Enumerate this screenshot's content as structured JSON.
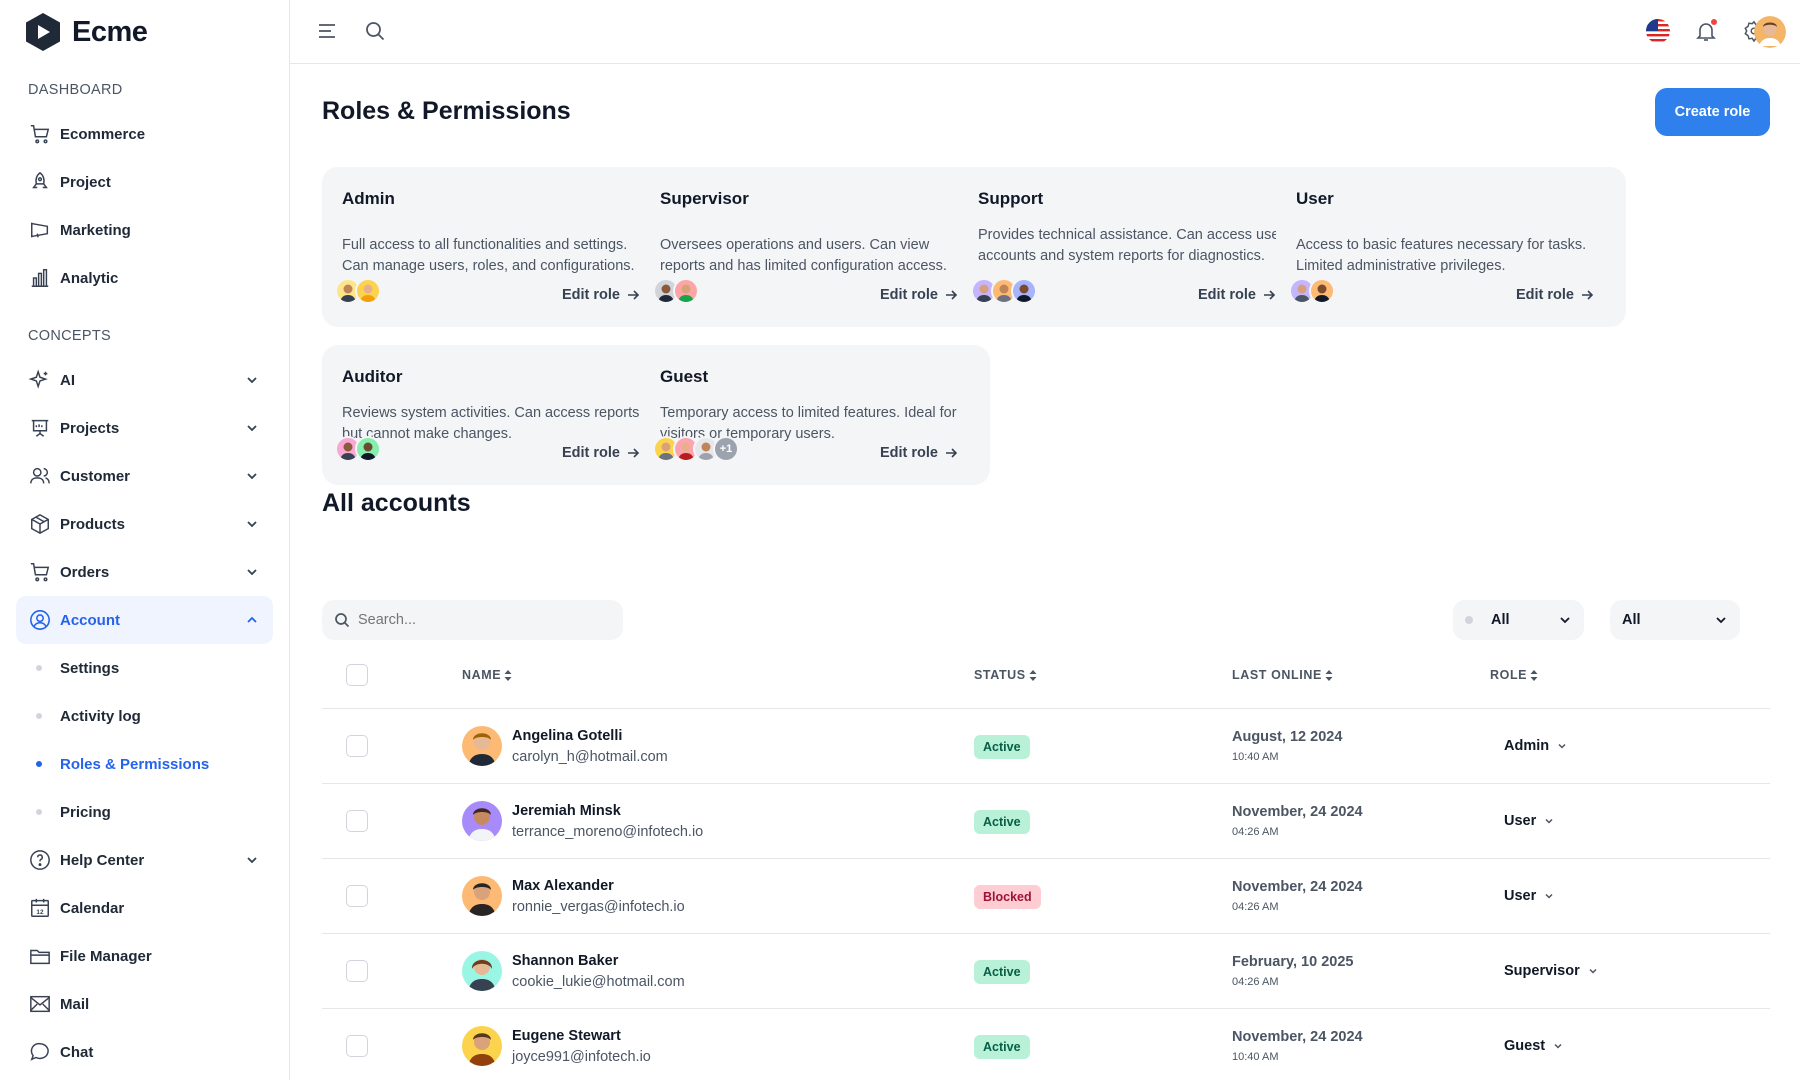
{
  "app": {
    "name": "Ecme"
  },
  "sidebar": {
    "sections": [
      {
        "title": "DASHBOARD",
        "items": [
          {
            "label": "Ecommerce",
            "icon": "shopping-cart-icon"
          },
          {
            "label": "Project",
            "icon": "rocket-icon"
          },
          {
            "label": "Marketing",
            "icon": "megaphone-icon"
          },
          {
            "label": "Analytic",
            "icon": "bar-chart-icon"
          }
        ]
      },
      {
        "title": "CONCEPTS",
        "items": [
          {
            "label": "AI",
            "icon": "sparkle-icon",
            "expandable": true
          },
          {
            "label": "Projects",
            "icon": "presentation-icon",
            "expandable": true
          },
          {
            "label": "Customer",
            "icon": "users-icon",
            "expandable": true
          },
          {
            "label": "Products",
            "icon": "box-icon",
            "expandable": true
          },
          {
            "label": "Orders",
            "icon": "cart-icon",
            "expandable": true
          },
          {
            "label": "Account",
            "icon": "user-circle-icon",
            "expandable": true,
            "open": true,
            "children": [
              "Settings",
              "Activity log",
              "Roles & Permissions",
              "Pricing"
            ],
            "active_child": "Roles & Permissions"
          },
          {
            "label": "Help Center",
            "icon": "help-circle-icon",
            "expandable": true
          },
          {
            "label": "Calendar",
            "icon": "calendar-icon",
            "calendar_day": "12"
          },
          {
            "label": "File Manager",
            "icon": "folder-icon"
          },
          {
            "label": "Mail",
            "icon": "mail-icon"
          },
          {
            "label": "Chat",
            "icon": "chat-icon"
          }
        ]
      }
    ]
  },
  "header": {
    "icons": [
      "menu-icon",
      "search-icon",
      "us-flag-icon",
      "bell-icon",
      "gear-icon",
      "avatar"
    ]
  },
  "page": {
    "title": "Roles & Permissions",
    "create_button": "Create role"
  },
  "roles": [
    {
      "name": "Admin",
      "description": "Full access to all functionalities and settings. Can manage users, roles, and configurations.",
      "avatars": 2,
      "edit_label": "Edit role"
    },
    {
      "name": "Supervisor",
      "description": "Oversees operations and users. Can view reports and has limited configuration access.",
      "avatars": 2,
      "edit_label": "Edit role"
    },
    {
      "name": "Support",
      "description": "Provides technical assistance. Can access user accounts and system reports for diagnostics.",
      "avatars": 3,
      "edit_label": "Edit role"
    },
    {
      "name": "User",
      "description": "Access to basic features necessary for tasks. Limited administrative privileges.",
      "avatars": 2,
      "edit_label": "Edit role"
    },
    {
      "name": "Auditor",
      "description": "Reviews system activities. Can access reports, but cannot make changes.",
      "avatars": 2,
      "edit_label": "Edit role"
    },
    {
      "name": "Guest",
      "description": "Temporary access to limited features. Ideal for visitors or temporary users.",
      "avatars": 3,
      "more": "+1",
      "edit_label": "Edit role"
    }
  ],
  "accounts": {
    "title": "All accounts",
    "search_placeholder": "Search...",
    "filter_status": "All",
    "filter_role": "All",
    "columns": [
      "NAME",
      "STATUS",
      "LAST ONLINE",
      "ROLE"
    ],
    "rows": [
      {
        "name": "Angelina Gotelli",
        "email": "carolyn_h@hotmail.com",
        "status": "Active",
        "date": "August, 12 2024",
        "time": "10:40 AM",
        "role": "Admin"
      },
      {
        "name": "Jeremiah Minsk",
        "email": "terrance_moreno@infotech.io",
        "status": "Active",
        "date": "November, 24 2024",
        "time": "04:26 AM",
        "role": "User"
      },
      {
        "name": "Max Alexander",
        "email": "ronnie_vergas@infotech.io",
        "status": "Blocked",
        "date": "November, 24 2024",
        "time": "04:26 AM",
        "role": "User"
      },
      {
        "name": "Shannon Baker",
        "email": "cookie_lukie@hotmail.com",
        "status": "Active",
        "date": "February, 10 2025",
        "time": "04:26 AM",
        "role": "Supervisor"
      },
      {
        "name": "Eugene Stewart",
        "email": "joyce991@infotech.io",
        "status": "Active",
        "date": "November, 24 2024",
        "time": "10:40 AM",
        "role": "Guest"
      }
    ]
  },
  "colors": {
    "primary": "#2f80ed",
    "active_nav_bg": "#eff4ff",
    "active_badge": "#b9f0d8",
    "blocked_badge": "#fecdd3",
    "card_bg": "#f4f5f7"
  }
}
